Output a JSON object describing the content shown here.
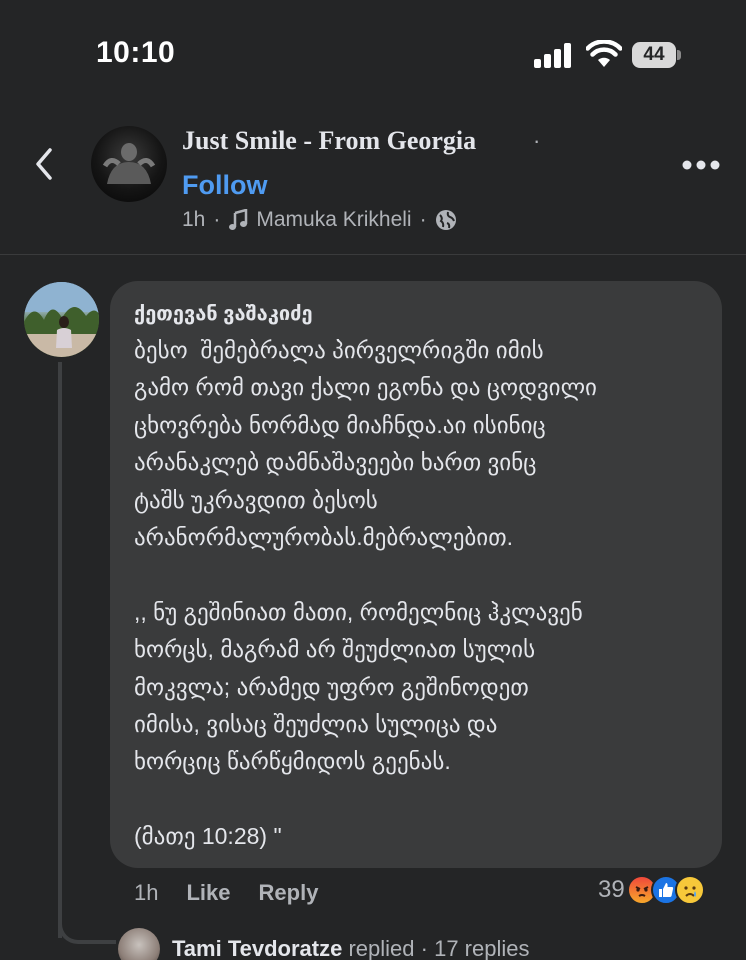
{
  "status": {
    "time": "10:10",
    "battery": "44"
  },
  "header": {
    "page_name": "Just Smile - From Georgia",
    "name_separator": "·",
    "follow_label": "Follow",
    "time_ago": "1h",
    "music_artist": "Mamuka Krikheli"
  },
  "comment": {
    "author": "ქეთევან ვაშაკიძე",
    "text": "ბესო  შემებრალა პირველრიგში იმის\nგამო რომ თავი ქალი ეგონა და ცოდვილი\nცხოვრება ნორმად მიაჩნდა.აი ისინიც\nარანაკლებ დამნაშავეები ხართ ვინც\nტაშს უკრავდით ბესოს\nარანორმალურობას.მებრალებით.\n\n,, ნუ გეშინიათ მათი, რომელნიც ჰკლავენ\nხორცს, მაგრამ არ შეუძლიათ სულის\nმოკვლა; არამედ უფრო გეშინოდეთ\nიმისა, ვისაც შეუძლია სულიცა და\nხორციც წარწყმიდოს გეენას.\n\n(მათე 10:28) \"",
    "time_ago": "1h",
    "like_label": "Like",
    "reply_label": "Reply",
    "reaction_count": "39",
    "reactions": [
      "angry-icon",
      "like-icon",
      "sad-icon"
    ]
  },
  "reply_preview": {
    "name": "Tami Tevdoratze",
    "action": "replied",
    "separator": "·",
    "replies": "17 replies"
  },
  "colors": {
    "background": "#242526",
    "bubble": "#3a3b3c",
    "link_blue": "#4f9bf1",
    "secondary_text": "#b0b3b8"
  }
}
